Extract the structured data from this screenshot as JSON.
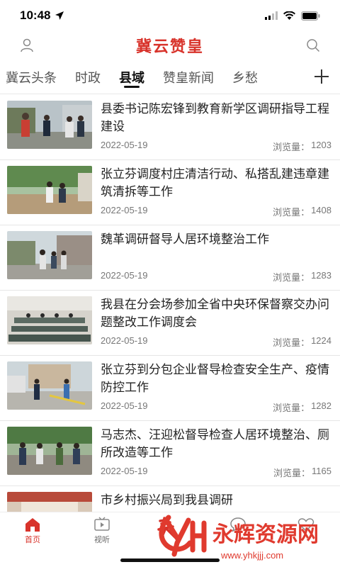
{
  "status_bar": {
    "time": "10:48"
  },
  "header": {
    "title": "冀云赞皇"
  },
  "tabs": [
    {
      "label": "冀云头条",
      "active": false
    },
    {
      "label": "时政",
      "active": false
    },
    {
      "label": "县域",
      "active": true
    },
    {
      "label": "赞皇新闻",
      "active": false
    },
    {
      "label": "乡愁",
      "active": false
    }
  ],
  "views_label": "浏览量：",
  "news": [
    {
      "title": "县委书记陈宏锋到教育新学区调研指导工程建设",
      "date": "2022-05-19",
      "views": "1203"
    },
    {
      "title": "张立芬调度村庄清洁行动、私搭乱建违章建筑清拆等工作",
      "date": "2022-05-19",
      "views": "1408"
    },
    {
      "title": "魏革调研督导人居环境整治工作",
      "date": "2022-05-19",
      "views": "1283"
    },
    {
      "title": "我县在分会场参加全省中央环保督察交办问题整改工作调度会",
      "date": "2022-05-19",
      "views": "1224"
    },
    {
      "title": "张立芬到分包企业督导检查安全生产、疫情防控工作",
      "date": "2022-05-19",
      "views": "1282"
    },
    {
      "title": "马志杰、汪迎松督导检查人居环境整治、厕所改造等工作",
      "date": "2022-05-19",
      "views": "1165"
    },
    {
      "title": "市乡村振兴局到我县调研",
      "date": "",
      "views": ""
    }
  ],
  "bottom_nav": [
    {
      "label": "首页",
      "active": true
    },
    {
      "label": "视听",
      "active": false
    },
    {
      "label": "",
      "active": false
    },
    {
      "label": "",
      "active": false
    },
    {
      "label": "",
      "active": false
    }
  ],
  "watermark": {
    "text": "永辉资源网",
    "url": "www.yhkjjj.com",
    "mark": "YH"
  },
  "colors": {
    "brand": "#d8332b",
    "text": "#222222",
    "meta": "#777777"
  }
}
